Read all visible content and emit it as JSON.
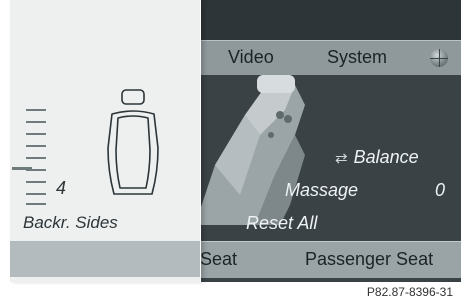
{
  "tabs": {
    "video": "Video",
    "system": "System"
  },
  "icons": {
    "globe": "globe-icon",
    "balance": "seat-balance-icon",
    "seat_illustration": "seat-illustration",
    "seat_outline": "seat-outline-icon"
  },
  "menu": {
    "balance_label": "Balance",
    "massage_label": "Massage",
    "massage_value": "0",
    "reset_label": "Reset All"
  },
  "bottom": {
    "seat_label": "Seat",
    "passenger_label": "Passenger Seat"
  },
  "left_panel": {
    "value": "4",
    "label": "Backr. Sides",
    "level": 0.4
  },
  "caption": "P82.87-8396-31",
  "colors": {
    "display_bg": "#3a4246",
    "tabbar_bg": "#8f999c",
    "panel_bg": "#eef0f0",
    "text_light": "#eef2f3"
  }
}
